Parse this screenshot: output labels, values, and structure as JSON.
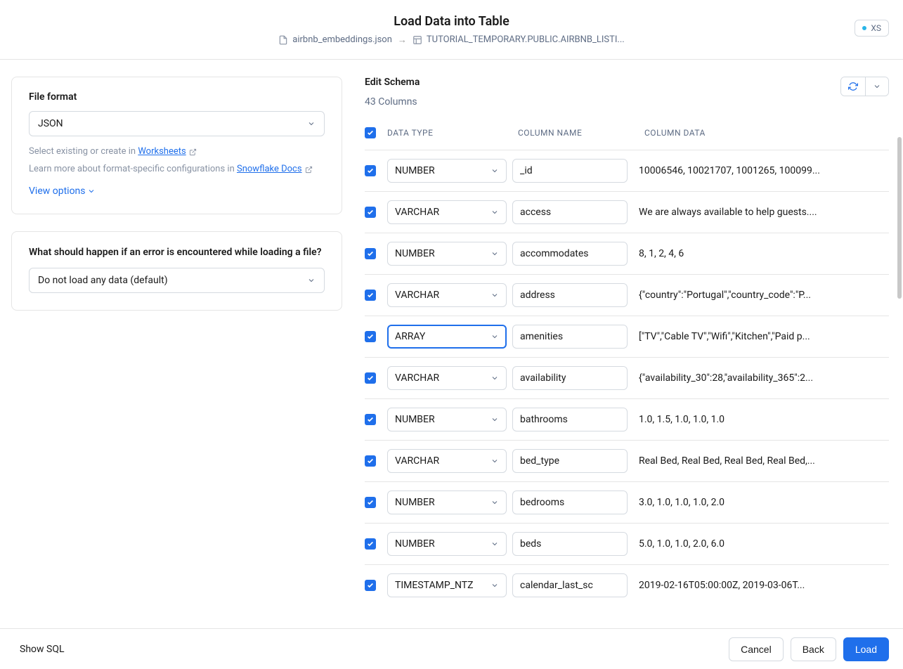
{
  "header": {
    "title": "Load Data into Table",
    "source_file": "airbnb_embeddings.json",
    "target_table": "TUTORIAL_TEMPORARY.PUBLIC.AIRBNB_LISTI...",
    "warehouse_size": "XS"
  },
  "left": {
    "file_format_label": "File format",
    "file_format_value": "JSON",
    "helper_prefix": "Select existing or create in ",
    "worksheets_link": "Worksheets",
    "helper2_prefix": "Learn more about format-specific configurations in ",
    "docs_link": "Snowflake Docs",
    "view_options": "View options",
    "error_card_title": "What should happen if an error is encountered while loading a file?",
    "error_option": "Do not load any data (default)"
  },
  "right": {
    "title": "Edit Schema",
    "column_count": "43 Columns",
    "headers": {
      "data_type": "DATA TYPE",
      "column_name": "COLUMN NAME",
      "column_data": "COLUMN DATA"
    },
    "columns": [
      {
        "type": "NUMBER",
        "name": "_id",
        "data": "10006546, 10021707, 1001265, 100099...",
        "focused": false
      },
      {
        "type": "VARCHAR",
        "name": "access",
        "data": "We are always available to help guests....",
        "focused": false
      },
      {
        "type": "NUMBER",
        "name": "accommodates",
        "data": "8, 1, 2, 4, 6",
        "focused": false
      },
      {
        "type": "VARCHAR",
        "name": "address",
        "data": "{\"country\":\"Portugal\",\"country_code\":\"P...",
        "focused": false
      },
      {
        "type": "ARRAY",
        "name": "amenities",
        "data": "[\"TV\",\"Cable TV\",\"Wifi\",\"Kitchen\",\"Paid p...",
        "focused": true
      },
      {
        "type": "VARCHAR",
        "name": "availability",
        "data": "{\"availability_30\":28,\"availability_365\":2...",
        "focused": false
      },
      {
        "type": "NUMBER",
        "name": "bathrooms",
        "data": "1.0, 1.5, 1.0, 1.0, 1.0",
        "focused": false
      },
      {
        "type": "VARCHAR",
        "name": "bed_type",
        "data": "Real Bed, Real Bed, Real Bed, Real Bed,...",
        "focused": false
      },
      {
        "type": "NUMBER",
        "name": "bedrooms",
        "data": "3.0, 1.0, 1.0, 1.0, 2.0",
        "focused": false
      },
      {
        "type": "NUMBER",
        "name": "beds",
        "data": "5.0, 1.0, 1.0, 2.0, 6.0",
        "focused": false
      },
      {
        "type": "TIMESTAMP_NTZ",
        "name": "calendar_last_sc",
        "data": "2019-02-16T05:00:00Z, 2019-03-06T...",
        "focused": false
      }
    ]
  },
  "footer": {
    "show_sql": "Show SQL",
    "cancel": "Cancel",
    "back": "Back",
    "load": "Load"
  }
}
